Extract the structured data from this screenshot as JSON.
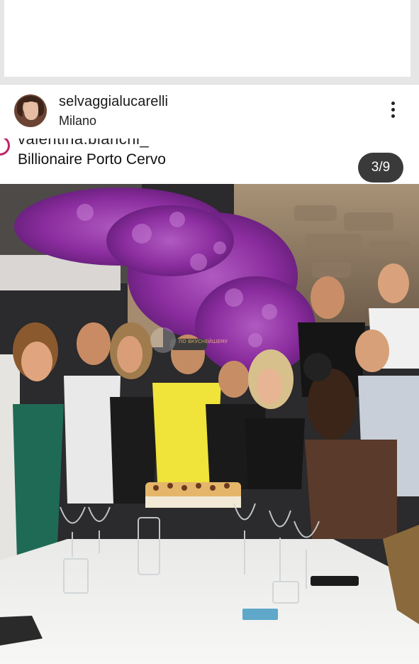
{
  "post": {
    "username": "selvaggialucarelli",
    "location": "Milano",
    "more_icon": "more-vertical-icon"
  },
  "caption": {
    "tag_cut": "valentina.bianchi_",
    "place": "Billionaire Porto Cervo",
    "counter": "3/9"
  },
  "photo": {
    "watermark": "ПО ВКУСНЕЙШЕМУ"
  },
  "colors": {
    "background": "#e9e9e9",
    "bougainvillea": "#8a2c9e",
    "table_cloth": "#f4f4f2",
    "counter_bg": "#3a3a3a"
  }
}
